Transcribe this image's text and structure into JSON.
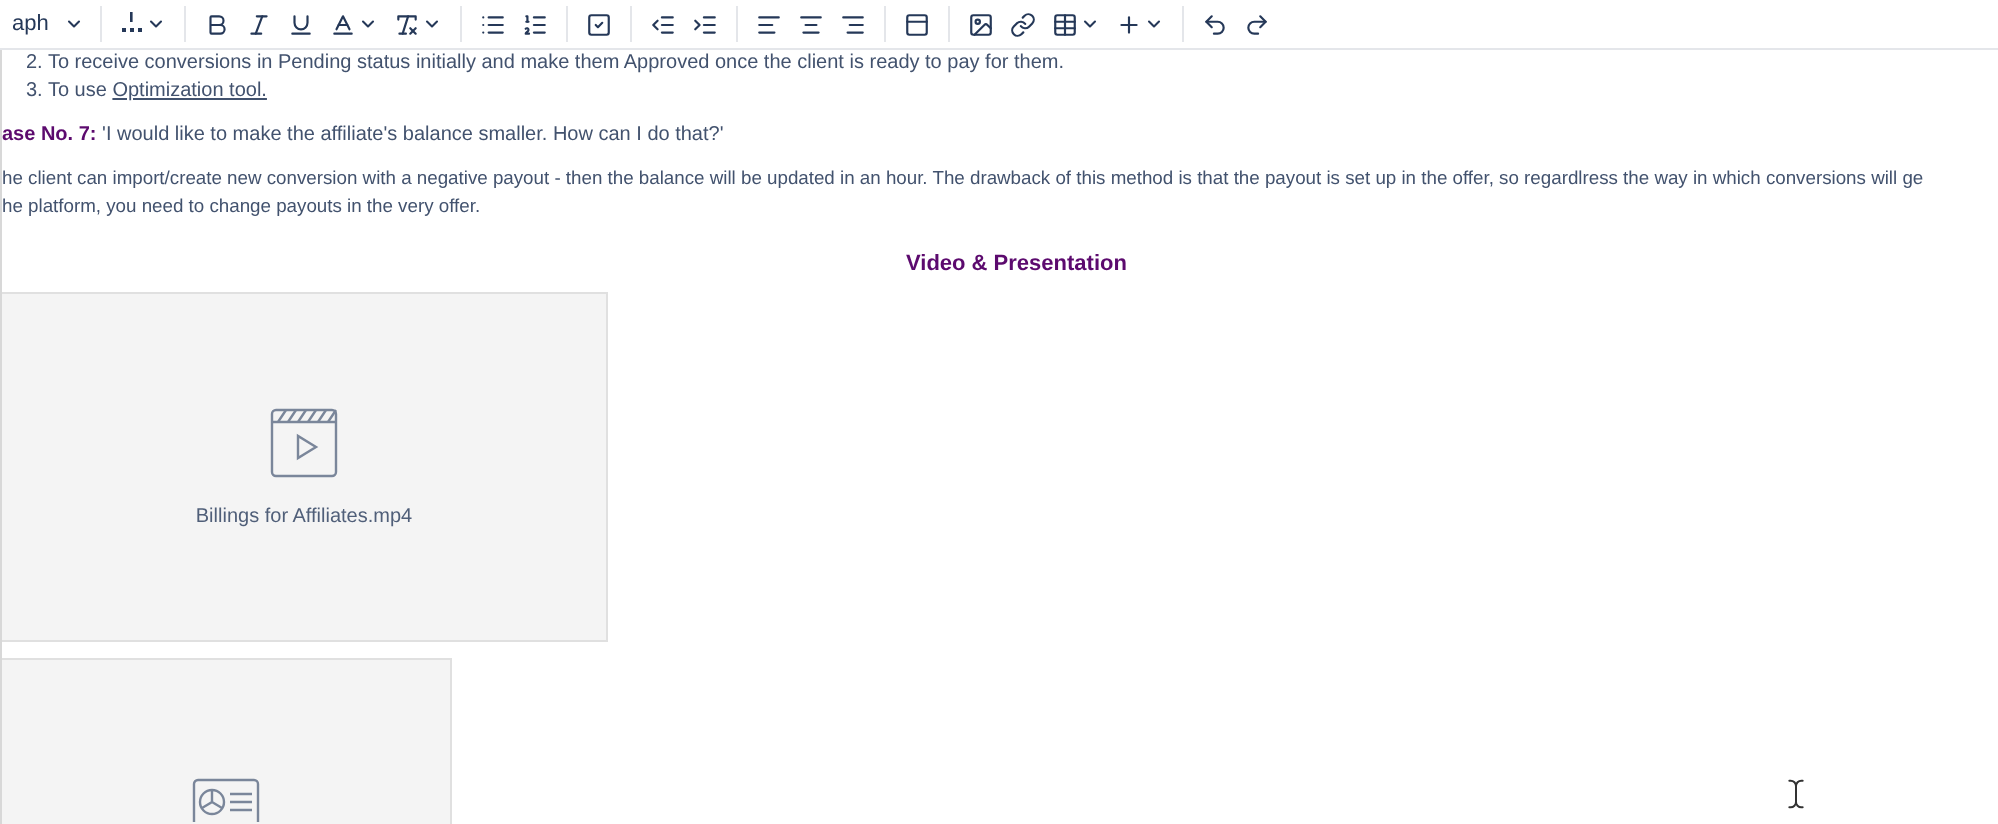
{
  "toolbar": {
    "paragraph_style": "aph",
    "groups": [
      [
        {
          "kind": "line-height",
          "dropdown": true
        }
      ],
      [
        {
          "kind": "bold",
          "dropdown": false
        },
        {
          "kind": "italic",
          "dropdown": false
        },
        {
          "kind": "underline",
          "dropdown": false
        },
        {
          "kind": "text-color",
          "dropdown": true
        },
        {
          "kind": "clear-format",
          "dropdown": true
        }
      ],
      [
        {
          "kind": "bullet-list",
          "dropdown": false
        },
        {
          "kind": "numbered-list",
          "dropdown": false
        }
      ],
      [
        {
          "kind": "task",
          "dropdown": false
        }
      ],
      [
        {
          "kind": "outdent",
          "dropdown": false
        },
        {
          "kind": "indent",
          "dropdown": false
        }
      ],
      [
        {
          "kind": "align-left",
          "dropdown": false
        },
        {
          "kind": "align-center",
          "dropdown": false
        },
        {
          "kind": "align-right",
          "dropdown": false
        }
      ],
      [
        {
          "kind": "layout",
          "dropdown": false
        }
      ],
      [
        {
          "kind": "image",
          "dropdown": false
        },
        {
          "kind": "link",
          "dropdown": false
        },
        {
          "kind": "table",
          "dropdown": true
        },
        {
          "kind": "insert",
          "dropdown": true
        }
      ],
      [
        {
          "kind": "undo",
          "dropdown": false
        },
        {
          "kind": "redo",
          "dropdown": false
        }
      ]
    ]
  },
  "list_items": [
    {
      "number": "2.",
      "text": "To receive conversions in Pending status initially and make them Approved once the client is ready to pay for them."
    },
    {
      "number": "3.",
      "text": "To use ",
      "link": "Optimization tool."
    }
  ],
  "case": {
    "label": "ase No. 7:",
    "question": "'I would like to make the affiliate's balance smaller. How can I do that?'"
  },
  "answer_lines": [
    "he client can import/create new conversion with a negative payout - then the balance will be updated in an hour. The drawback of this method is that the payout is set up in the offer, so regardlress the way in which conversions will ge",
    "he platform, you need to change payouts in the very offer."
  ],
  "media_heading": "Video & Presentation",
  "attachments": [
    {
      "kind": "video",
      "file_name": "Billings for Affiliates.mp4"
    },
    {
      "kind": "presentation"
    }
  ]
}
